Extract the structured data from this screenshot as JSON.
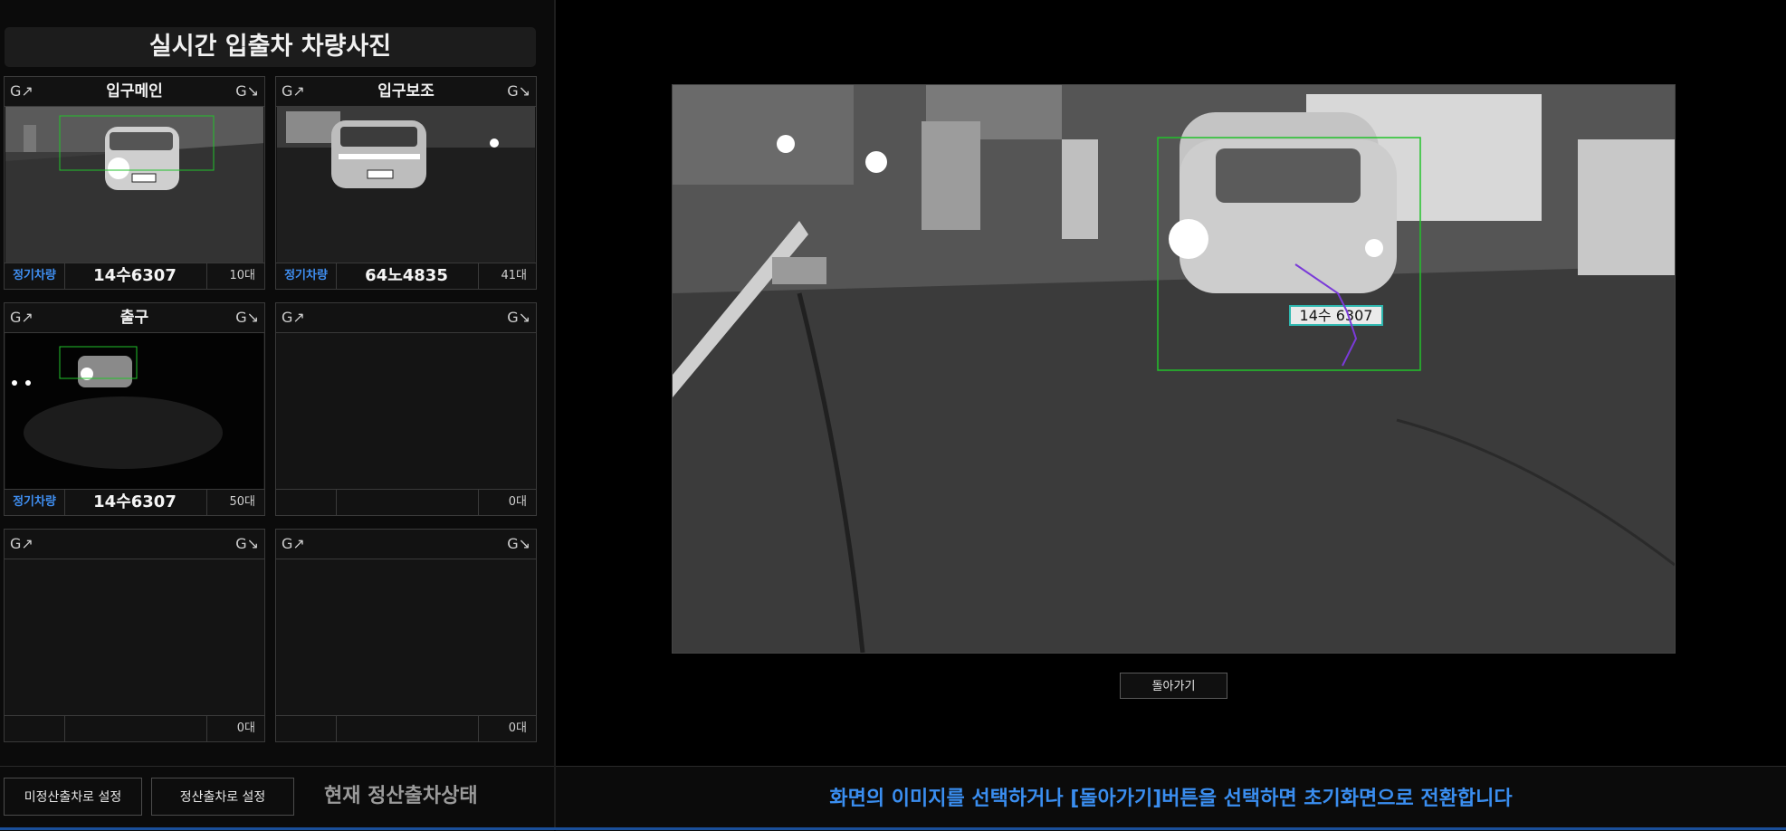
{
  "left_panel": {
    "title": "실시간 입출차 차량사진"
  },
  "cameras": [
    {
      "g_left": "G↗",
      "g_right": "G↘",
      "name": "입구메인",
      "tag": "정기차량",
      "plate": "14수6307",
      "count": "10대"
    },
    {
      "g_left": "G↗",
      "g_right": "G↘",
      "name": "입구보조",
      "tag": "정기차량",
      "plate": "64노4835",
      "count": "41대"
    },
    {
      "g_left": "G↗",
      "g_right": "G↘",
      "name": "출구",
      "tag": "정기차량",
      "plate": "14수6307",
      "count": "50대"
    },
    {
      "g_left": "G↗",
      "g_right": "G↘",
      "name": "",
      "tag": "",
      "plate": "",
      "count": "0대"
    },
    {
      "g_left": "G↗",
      "g_right": "G↘",
      "name": "",
      "tag": "",
      "plate": "",
      "count": "0대"
    },
    {
      "g_left": "G↗",
      "g_right": "G↘",
      "name": "",
      "tag": "",
      "plate": "",
      "count": "0대"
    }
  ],
  "bottom_left": {
    "unpaid_exit_button": "미정산출차로 설정",
    "paid_exit_button": "정산출차로 설정",
    "status_text": "현재 정산출차상태"
  },
  "main_view": {
    "plate_overlay": "14수 6307",
    "back_button": "돌아가기"
  },
  "bottom_right": {
    "info_text": "화면의 이미지를 선택하거나 [돌아가기]버튼을 선택하면 초기화면으로 전환합니다"
  },
  "colors": {
    "accent": "#3a8ef0",
    "detect_box": "#22c22b",
    "plate_box": "#2fb8b0"
  }
}
